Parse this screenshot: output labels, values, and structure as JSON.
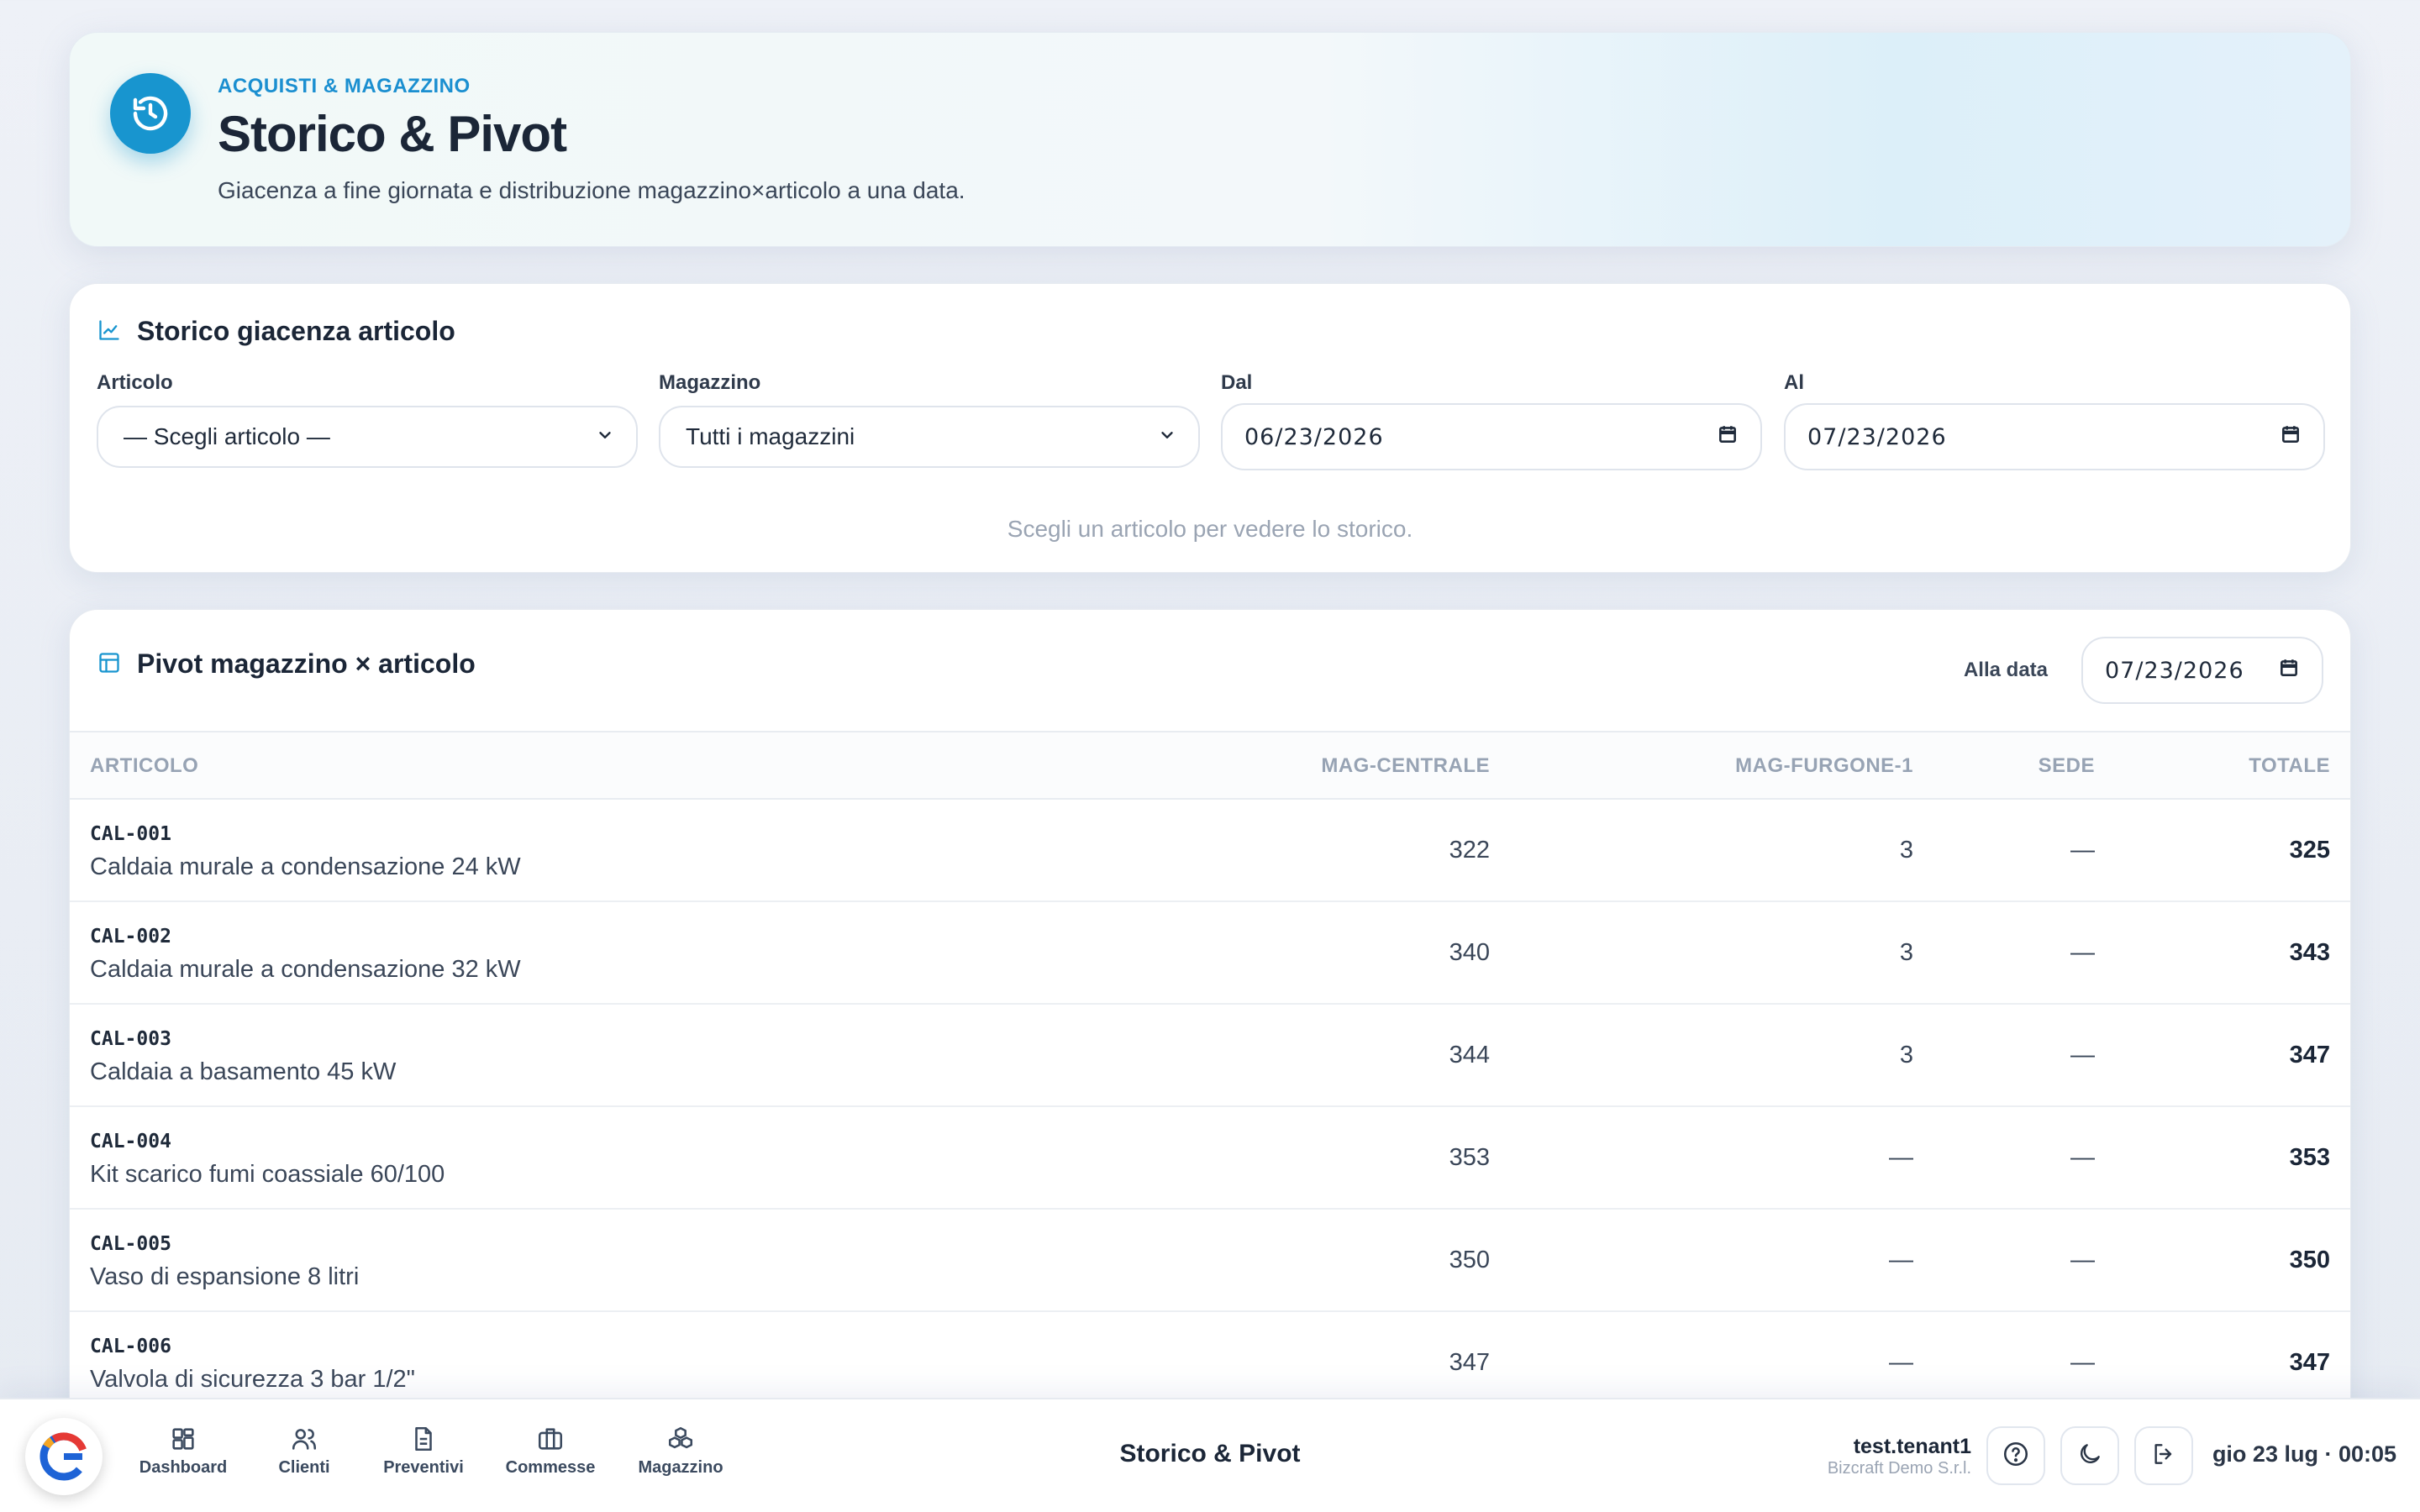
{
  "hero": {
    "kicker": "ACQUISTI & MAGAZZINO",
    "title": "Storico & Pivot",
    "subtitle": "Giacenza a fine giornata e distribuzione magazzino×articolo a una data.",
    "icon": "history-icon"
  },
  "history": {
    "title": "Storico giacenza articolo",
    "icon": "line-chart-icon",
    "article_label": "Articolo",
    "article_value": "— Scegli articolo —",
    "warehouse_label": "Magazzino",
    "warehouse_value": "Tutti i magazzini",
    "from_label": "Dal",
    "from_value": "06/23/2026",
    "to_label": "Al",
    "to_value": "07/23/2026",
    "hint": "Scegli un articolo per vedere lo storico."
  },
  "pivot": {
    "title": "Pivot magazzino × articolo",
    "icon": "table-icon",
    "date_label": "Alla data",
    "date_value": "07/23/2026",
    "columns": [
      "ARTICOLO",
      "MAG-CENTRALE",
      "MAG-FURGONE-1",
      "SEDE",
      "TOTALE"
    ],
    "rows": [
      {
        "code": "CAL-001",
        "desc": "Caldaia murale a condensazione 24 kW",
        "c1": "322",
        "c2": "3",
        "c3": "—",
        "tot": "325"
      },
      {
        "code": "CAL-002",
        "desc": "Caldaia murale a condensazione 32 kW",
        "c1": "340",
        "c2": "3",
        "c3": "—",
        "tot": "343"
      },
      {
        "code": "CAL-003",
        "desc": "Caldaia a basamento 45 kW",
        "c1": "344",
        "c2": "3",
        "c3": "—",
        "tot": "347"
      },
      {
        "code": "CAL-004",
        "desc": "Kit scarico fumi coassiale 60/100",
        "c1": "353",
        "c2": "—",
        "c3": "—",
        "tot": "353"
      },
      {
        "code": "CAL-005",
        "desc": "Vaso di espansione 8 litri",
        "c1": "350",
        "c2": "—",
        "c3": "—",
        "tot": "350"
      },
      {
        "code": "CAL-006",
        "desc": "Valvola di sicurezza 3 bar 1/2\"",
        "c1": "347",
        "c2": "—",
        "c3": "—",
        "tot": "347"
      }
    ]
  },
  "nav": {
    "items": [
      {
        "label": "Dashboard",
        "icon": "dashboard-icon"
      },
      {
        "label": "Clienti",
        "icon": "users-icon"
      },
      {
        "label": "Preventivi",
        "icon": "document-icon"
      },
      {
        "label": "Commesse",
        "icon": "briefcase-icon"
      },
      {
        "label": "Magazzino",
        "icon": "boxes-icon"
      }
    ],
    "page_title": "Storico & Pivot",
    "user_name": "test.tenant1",
    "user_org": "Bizcraft Demo S.r.l.",
    "clock": "gio 23 lug · 00:05"
  },
  "colors": {
    "accent": "#1895cf",
    "brand_red": "#e53935",
    "brand_blue": "#1e63d6"
  }
}
